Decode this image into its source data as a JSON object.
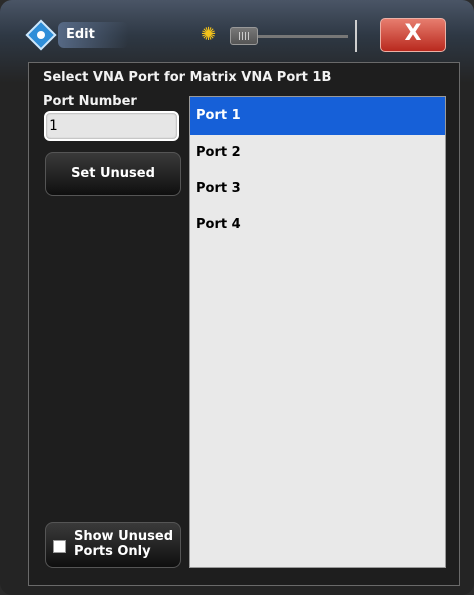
{
  "window": {
    "title": "Edit",
    "close_label": "X"
  },
  "heading": "Select VNA Port for Matrix VNA Port 1B",
  "port_number": {
    "label": "Port Number",
    "value": "1"
  },
  "buttons": {
    "set_unused": "Set Unused",
    "show_unused_line1": "Show Unused",
    "show_unused_line2": "Ports Only"
  },
  "ports": [
    {
      "label": "Port 1",
      "selected": true
    },
    {
      "label": "Port 2",
      "selected": false
    },
    {
      "label": "Port 3",
      "selected": false
    },
    {
      "label": "Port 4",
      "selected": false
    }
  ],
  "show_unused_checked": false,
  "colors": {
    "selection": "#1660d8",
    "close": "#c8382a",
    "accent_sun": "#f2c21b"
  },
  "icons": [
    "app-logo-icon",
    "sun-icon",
    "close-icon",
    "checkbox-icon"
  ]
}
